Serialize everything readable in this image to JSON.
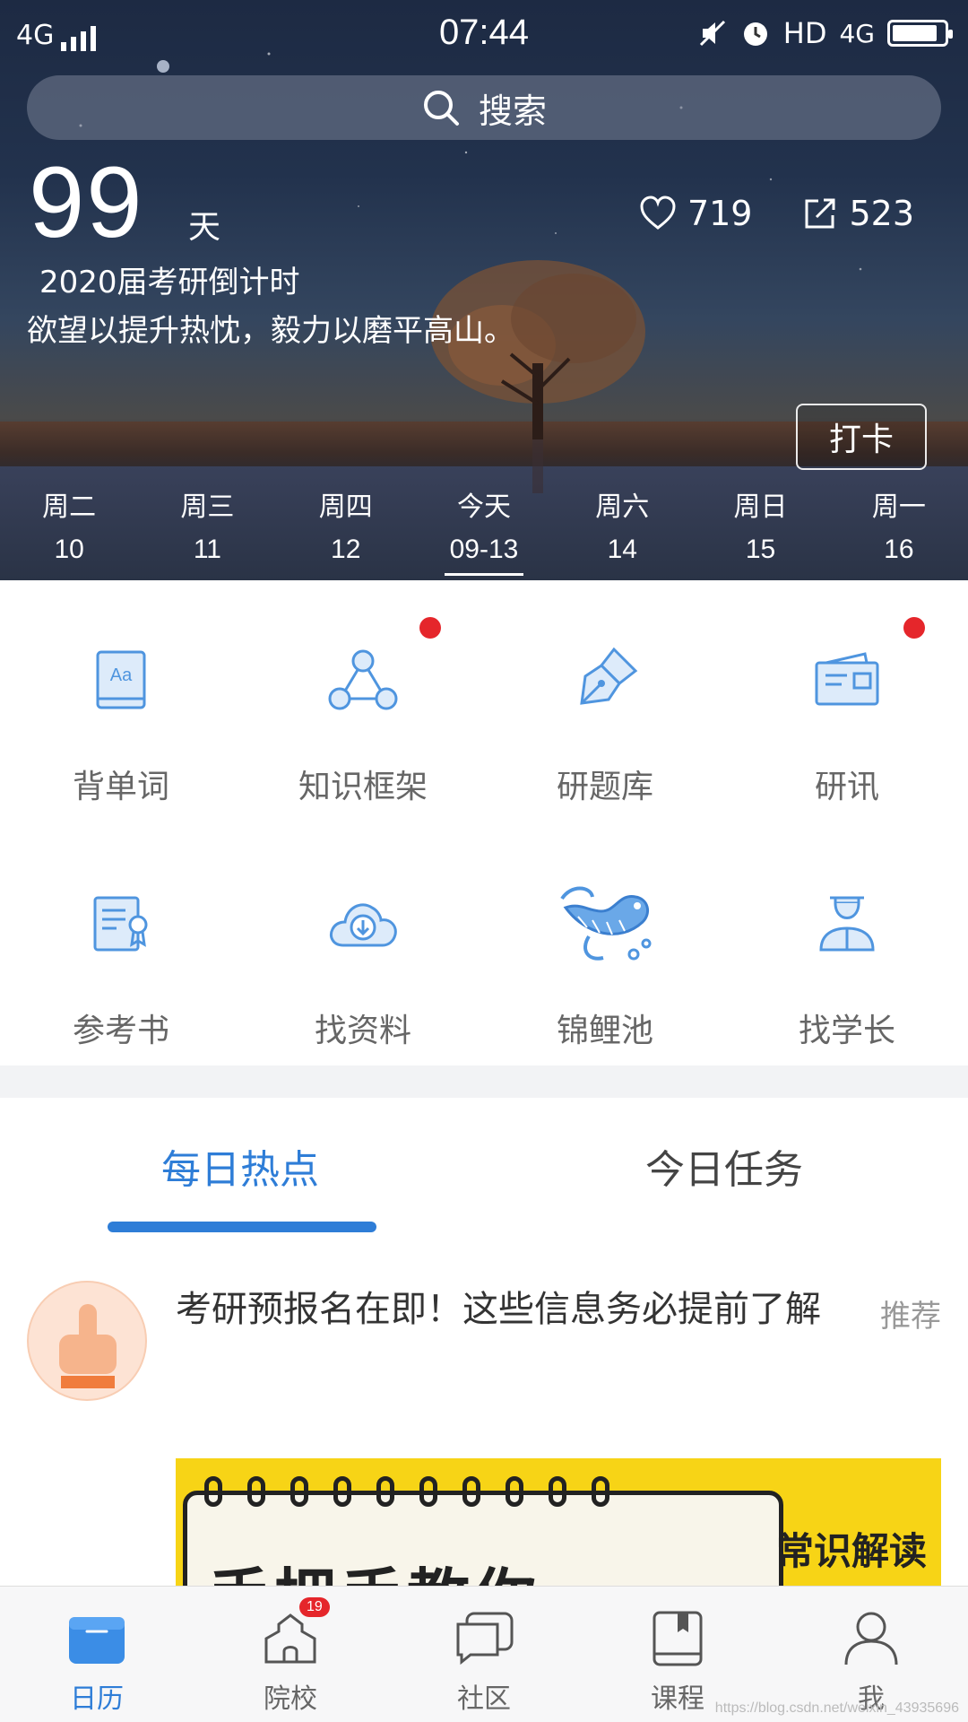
{
  "status_bar": {
    "network": "4G",
    "time": "07:44",
    "hd": "HD",
    "network_right": "4G",
    "battery_level": 0.85
  },
  "search": {
    "placeholder": "搜索"
  },
  "countdown": {
    "days": "99",
    "unit": "天",
    "label": "2020届考研倒计时",
    "motto": "欲望以提升热忱，毅力以磨平高山。"
  },
  "stats": {
    "likes": "719",
    "shares": "523"
  },
  "checkin_label": "打卡",
  "week": [
    {
      "weekday": "周二",
      "date": "10"
    },
    {
      "weekday": "周三",
      "date": "11"
    },
    {
      "weekday": "周四",
      "date": "12"
    },
    {
      "weekday": "今天",
      "date": "09-13",
      "today": true
    },
    {
      "weekday": "周六",
      "date": "14"
    },
    {
      "weekday": "周日",
      "date": "15"
    },
    {
      "weekday": "周一",
      "date": "16"
    }
  ],
  "features": [
    {
      "label": "背单词",
      "icon": "vocabulary-book-icon",
      "dot": false
    },
    {
      "label": "知识框架",
      "icon": "knowledge-network-icon",
      "dot": true
    },
    {
      "label": "研题库",
      "icon": "fountain-pen-icon",
      "dot": false
    },
    {
      "label": "研讯",
      "icon": "news-card-icon",
      "dot": true
    },
    {
      "label": "参考书",
      "icon": "certificate-document-icon",
      "dot": false
    },
    {
      "label": "找资料",
      "icon": "cloud-download-icon",
      "dot": false
    },
    {
      "label": "锦鲤池",
      "icon": "koi-fish-icon",
      "dot": false
    },
    {
      "label": "找学长",
      "icon": "graduate-person-icon",
      "dot": false
    }
  ],
  "tabs": [
    {
      "label": "每日热点",
      "active": true
    },
    {
      "label": "今日任务",
      "active": false
    }
  ],
  "news": {
    "title": "考研预报名在即！这些信息务必提前了解",
    "tag": "推荐",
    "banner_main_text": "手把手教你",
    "banner_side_text": "常识解读"
  },
  "bottom_nav": [
    {
      "label": "日历",
      "icon": "calendar-icon",
      "active": true
    },
    {
      "label": "院校",
      "icon": "school-icon",
      "active": false,
      "badge": "19"
    },
    {
      "label": "社区",
      "icon": "community-chat-icon",
      "active": false
    },
    {
      "label": "课程",
      "icon": "course-book-icon",
      "active": false
    },
    {
      "label": "我",
      "icon": "profile-person-icon",
      "active": false
    }
  ],
  "watermark": "https://blog.csdn.net/weixin_43935696",
  "colors": {
    "accent": "#2e7dd7",
    "badge_red": "#e5262b",
    "icon_blue": "#4f95df",
    "banner_yellow": "#f7d416"
  }
}
